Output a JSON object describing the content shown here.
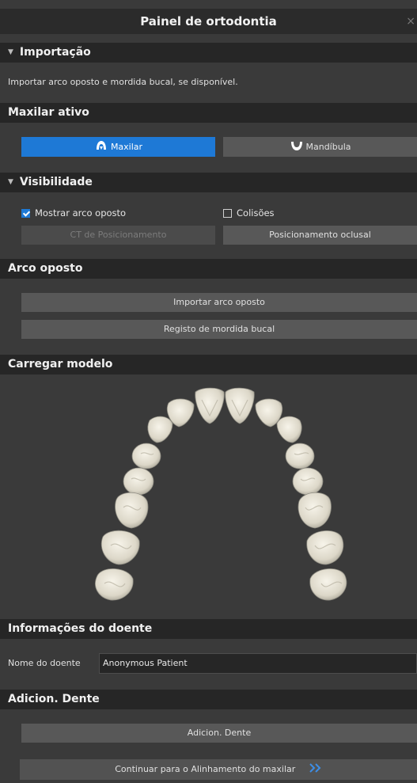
{
  "panel": {
    "title": "Painel de ortodontia",
    "close_glyph": "×"
  },
  "import_section": {
    "title": "Importação",
    "description": "Importar arco oposto e mordida bucal, se disponível."
  },
  "active_jaw": {
    "title": "Maxilar ativo",
    "maxilla_label": "Maxilar",
    "mandible_label": "Mandíbula",
    "selected": "Maxilar",
    "maxilla_icon": "upper-jaw-icon",
    "mandible_icon": "lower-jaw-icon"
  },
  "visibility": {
    "title": "Visibilidade",
    "show_opposite_label": "Mostrar arco oposto",
    "show_opposite_checked": true,
    "collisions_label": "Colisões",
    "collisions_checked": false,
    "ct_positioning_label": "CT de Posicionamento",
    "occlusal_positioning_label": "Posicionamento oclusal"
  },
  "opposite_arch": {
    "title": "Arco oposto",
    "import_label": "Importar arco oposto",
    "bite_label": "Registo de mordida bucal"
  },
  "load_model": {
    "title": "Carregar modelo"
  },
  "patient_info": {
    "title": "Informações do doente",
    "name_label": "Nome do doente",
    "name_value": "Anonymous Patient"
  },
  "add_tooth": {
    "title": "Adicion. Dente",
    "button_label": "Adicion. Dente"
  },
  "footer": {
    "continue_label": "Continuar para o Alinhamento do maxilar",
    "continue_icon": "double-chevron-right-icon"
  },
  "colors": {
    "accent": "#1e79d6",
    "header_bg": "#262626",
    "panel_bg": "#3a3a3a",
    "button_bg": "#585858"
  }
}
